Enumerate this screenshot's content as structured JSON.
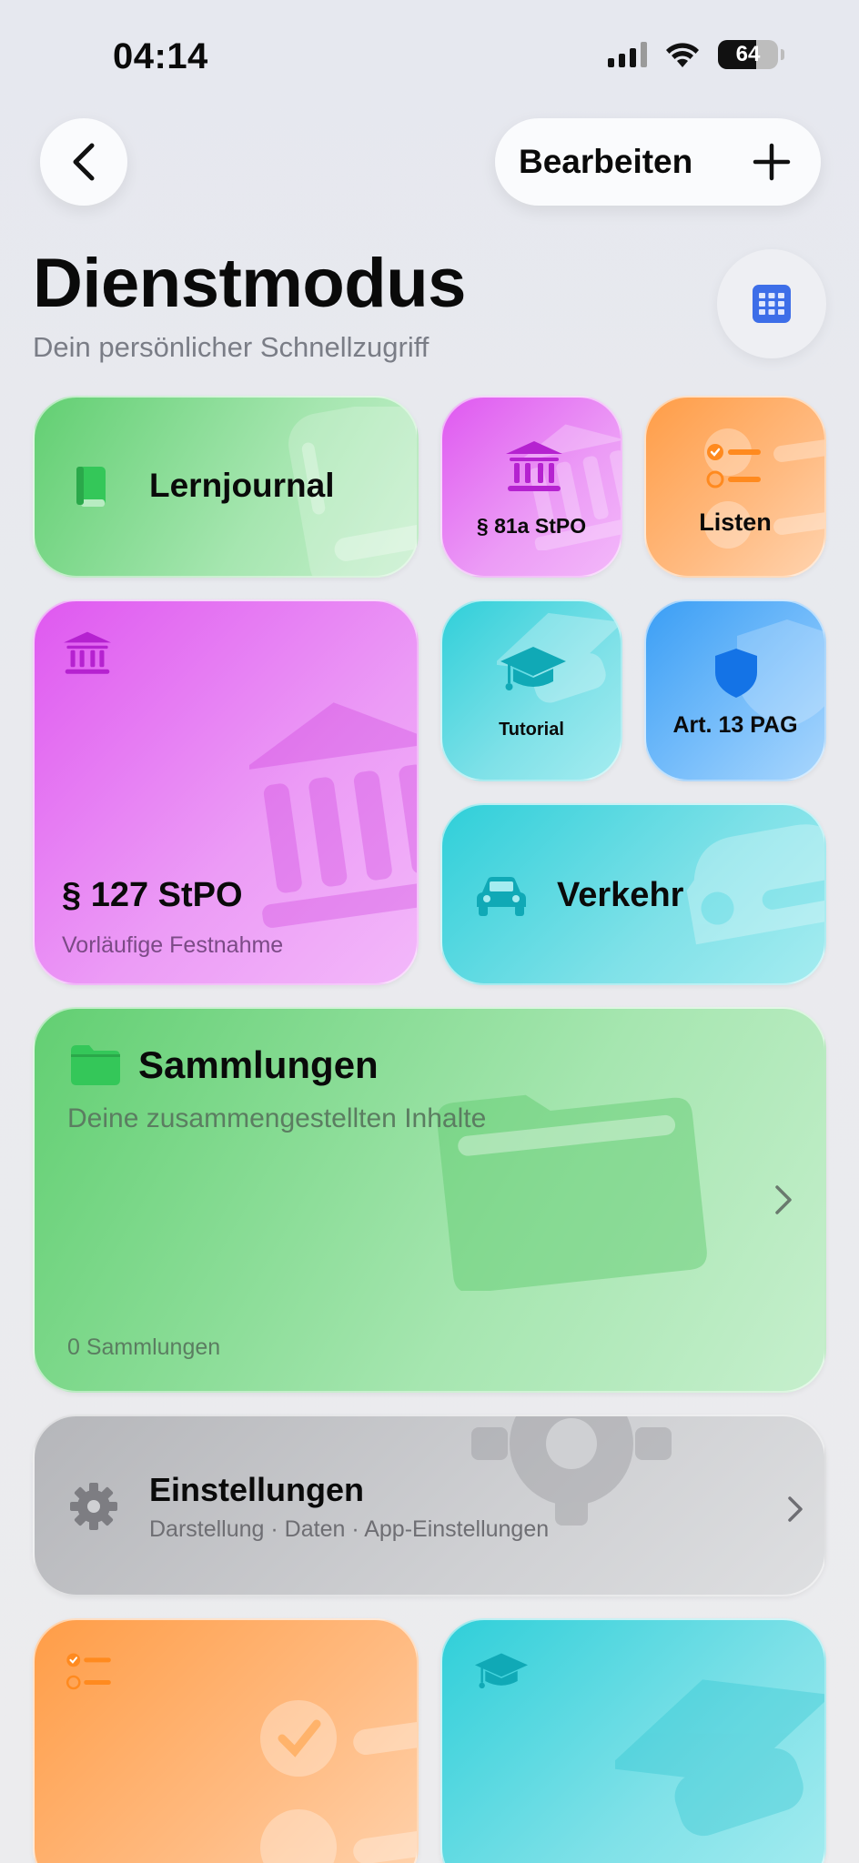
{
  "status_bar": {
    "time": "04:14",
    "battery": "64"
  },
  "nav": {
    "edit_label": "Bearbeiten"
  },
  "header": {
    "title": "Dienstmodus",
    "subtitle": "Dein persönlicher Schnellzugriff"
  },
  "tiles": {
    "lernjournal": {
      "label": "Lernjournal",
      "icon": "book-icon",
      "color": "#34c759"
    },
    "stpo81a": {
      "label": "§ 81a StPO",
      "icon": "courthouse-icon",
      "color": "#c93de0"
    },
    "listen": {
      "label": "Listen",
      "icon": "checklist-icon",
      "color": "#ff9f43"
    },
    "stpo127": {
      "label": "§ 127 StPO",
      "caption": "Vorläufige Festnahme",
      "icon": "courthouse-icon",
      "color": "#c93de0"
    },
    "tutorial": {
      "label": "Tutorial",
      "icon": "graduation-cap-icon",
      "color": "#18b9c6"
    },
    "art13": {
      "label": "Art. 13 PAG",
      "icon": "shield-icon",
      "color": "#1e7cf0"
    },
    "verkehr": {
      "label": "Verkehr",
      "icon": "car-icon",
      "color": "#18b9c6"
    },
    "sammlungen": {
      "label": "Sammlungen",
      "caption": "Deine zusammengestellten Inhalte",
      "count": "0 Sammlungen",
      "icon": "folder-icon",
      "color": "#34c759"
    },
    "einstellungen": {
      "label": "Einstellungen",
      "caption": "Darstellung · Daten · App-Einstellungen",
      "icon": "gear-icon",
      "color": "#8e8e93"
    }
  }
}
